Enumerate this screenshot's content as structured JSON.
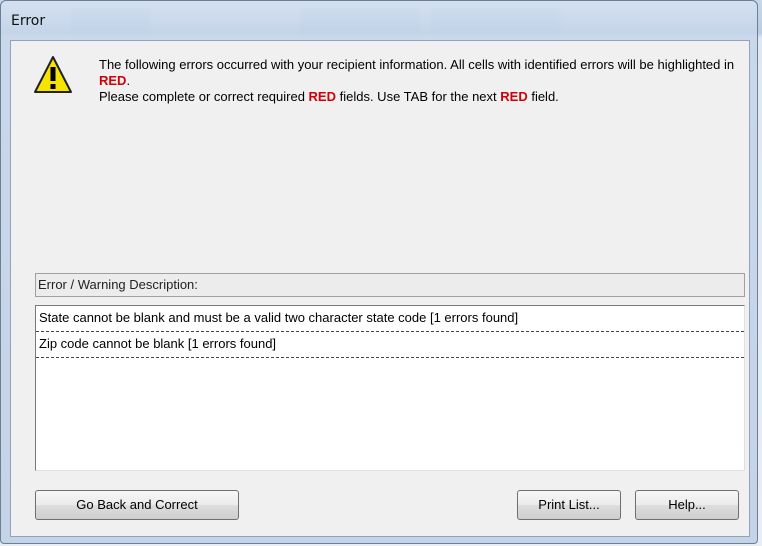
{
  "window": {
    "title": "Error"
  },
  "message": {
    "line1_pre": "The following errors occurred with your recipient information. All cells with identified errors will be highlighted in ",
    "line1_red": "RED",
    "line1_post": ".",
    "line2_pre": "Please complete or correct required ",
    "line2_red1": "RED",
    "line2_mid": " fields. Use TAB for the next ",
    "line2_red2": "RED",
    "line2_post": " field."
  },
  "list": {
    "header": "Error / Warning Description:",
    "items": [
      "State cannot be blank and must be a valid two character state code [1 errors found]",
      "Zip code cannot be blank [1 errors found]"
    ]
  },
  "buttons": {
    "back": "Go Back and Correct",
    "print": "Print List...",
    "help": "Help..."
  },
  "icons": {
    "warning": "warning-icon"
  },
  "colors": {
    "highlight_red": "#d0000a",
    "warning_yellow": "#f5e400"
  }
}
